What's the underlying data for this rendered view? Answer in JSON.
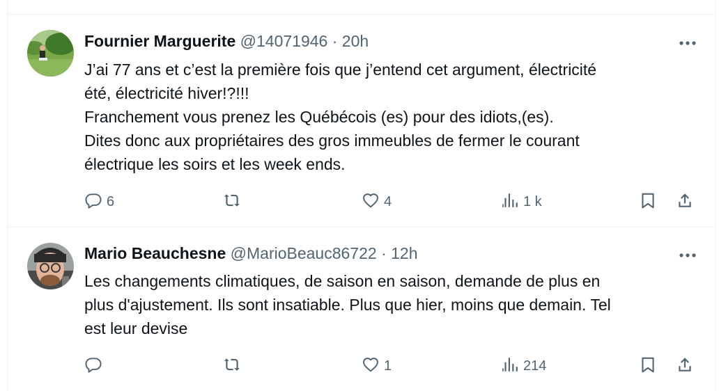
{
  "tweets": [
    {
      "author": "Fournier Marguerite",
      "handle": "@14071946",
      "separator": "·",
      "time": "20h",
      "lines": [
        "J’ai 77 ans et c’est la première fois que j’entend cet argument, électricité",
        "été, électricité hiver!?!!!",
        "Franchement vous prenez les Québécois (es) pour des idiots,(es).",
        "Dites donc aux propriétaires des gros immeubles de fermer le courant",
        "électrique les soirs et les week ends."
      ],
      "replies": "6",
      "reposts": "",
      "likes": "4",
      "views": "1 k"
    },
    {
      "author": "Mario Beauchesne",
      "handle": "@MarioBeauc86722",
      "separator": "·",
      "time": "12h",
      "lines": [
        "Les changements climatiques, de saison en saison, demande de plus en",
        "plus d'ajustement. Ils sont insatiable. Plus que hier, moins que demain. Tel",
        "est leur devise"
      ],
      "replies": "",
      "reposts": "",
      "likes": "1",
      "views": "214"
    }
  ],
  "icons": {
    "more": "more-horizontal-icon",
    "reply": "reply-bubble-icon",
    "repost": "repost-icon",
    "like": "heart-icon",
    "views": "views-bar-chart-icon",
    "bookmark": "bookmark-icon",
    "share": "share-upload-icon"
  },
  "colors": {
    "text": "#0f1419",
    "secondary": "#536471",
    "divider": "#eff3f4"
  }
}
